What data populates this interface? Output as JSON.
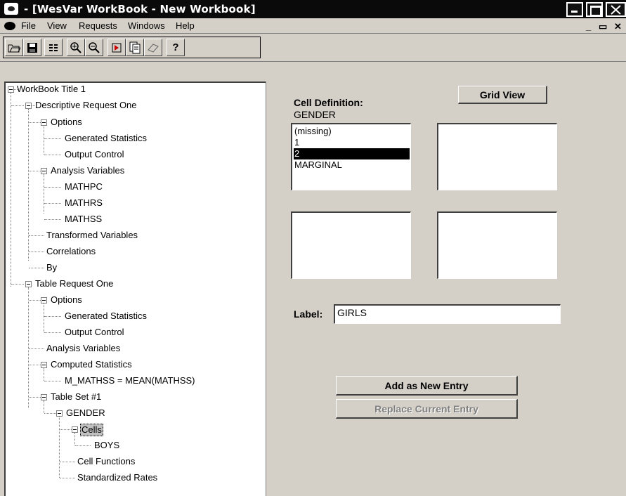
{
  "window": {
    "title": "- [WesVar WorkBook - New Workbook]"
  },
  "menu": {
    "items": [
      "File",
      "View",
      "Requests",
      "Windows",
      "Help"
    ]
  },
  "toolbar": {
    "help_label": "?"
  },
  "tree": {
    "root": "WorkBook Title 1",
    "descriptive_request": "Descriptive Request One",
    "d_options": "Options",
    "d_generated_statistics": "Generated Statistics",
    "d_output_control": "Output Control",
    "d_analysis_variables": "Analysis Variables",
    "d_var_1": "MATHPC",
    "d_var_2": "MATHRS",
    "d_var_3": "MATHSS",
    "d_transformed_variables": "Transformed Variables",
    "d_correlations": "Correlations",
    "d_by": "By",
    "table_request": "Table Request One",
    "t_options": "Options",
    "t_generated_statistics": "Generated Statistics",
    "t_output_control": "Output Control",
    "t_analysis_variables": "Analysis Variables",
    "t_computed_statistics": "Computed Statistics",
    "t_computed_1": "M_MATHSS = MEAN(MATHSS)",
    "t_table_set": "Table Set #1",
    "t_gender": "GENDER",
    "t_cells": "Cells",
    "t_cell_boys": "BOYS",
    "t_cell_functions": "Cell Functions",
    "t_standardized_rates": "Standardized Rates"
  },
  "panel": {
    "cell_definition_label": "Cell Definition:",
    "variable_name": "GENDER",
    "grid_view_label": "Grid View",
    "list_items": [
      "(missing)",
      "1",
      "2",
      "MARGINAL"
    ],
    "selected_index": 2,
    "label_caption": "Label:",
    "label_value": "GIRLS",
    "add_button": "Add as New Entry",
    "replace_button": "Replace Current Entry"
  }
}
